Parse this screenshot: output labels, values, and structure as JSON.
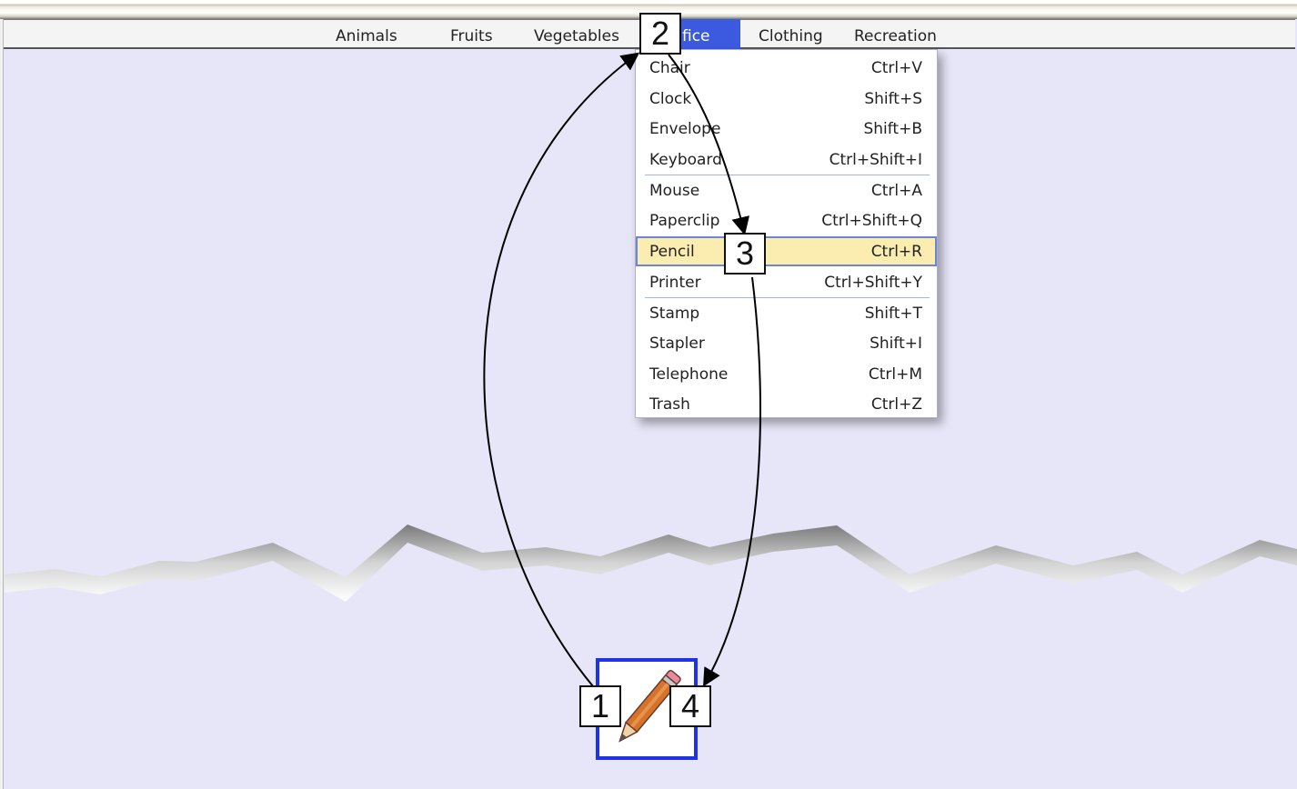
{
  "menubar": {
    "items": [
      {
        "label": "Animals"
      },
      {
        "label": "Fruits"
      },
      {
        "label": "Vegetables"
      },
      {
        "label": "fice"
      },
      {
        "label": "Clothing"
      },
      {
        "label": "Recreation"
      }
    ],
    "active_item": "Office",
    "accent_color": "#3c5ae0"
  },
  "dropdown": {
    "items": [
      {
        "label": "Chair",
        "shortcut": "Ctrl+V"
      },
      {
        "label": "Clock",
        "shortcut": "Shift+S"
      },
      {
        "label": "Envelope",
        "shortcut": "Shift+B"
      },
      {
        "label": "Keyboard",
        "shortcut": "Ctrl+Shift+I"
      },
      {
        "label": "Mouse",
        "shortcut": "Ctrl+A"
      },
      {
        "label": "Paperclip",
        "shortcut": "Ctrl+Shift+Q"
      },
      {
        "label": "Pencil",
        "shortcut": "Ctrl+R"
      },
      {
        "label": "Printer",
        "shortcut": "Ctrl+Shift+Y"
      },
      {
        "label": "Stamp",
        "shortcut": "Shift+T"
      },
      {
        "label": "Stapler",
        "shortcut": "Shift+I"
      },
      {
        "label": "Telephone",
        "shortcut": "Ctrl+M"
      },
      {
        "label": "Trash",
        "shortcut": "Ctrl+Z"
      }
    ],
    "highlighted_item": "Pencil",
    "highlight_color": "#fbecb0"
  },
  "target": {
    "icon": "pencil-icon",
    "border_color": "#1f33e6"
  },
  "steps": [
    {
      "label": "1"
    },
    {
      "label": "2"
    },
    {
      "label": "3"
    },
    {
      "label": "4"
    }
  ]
}
